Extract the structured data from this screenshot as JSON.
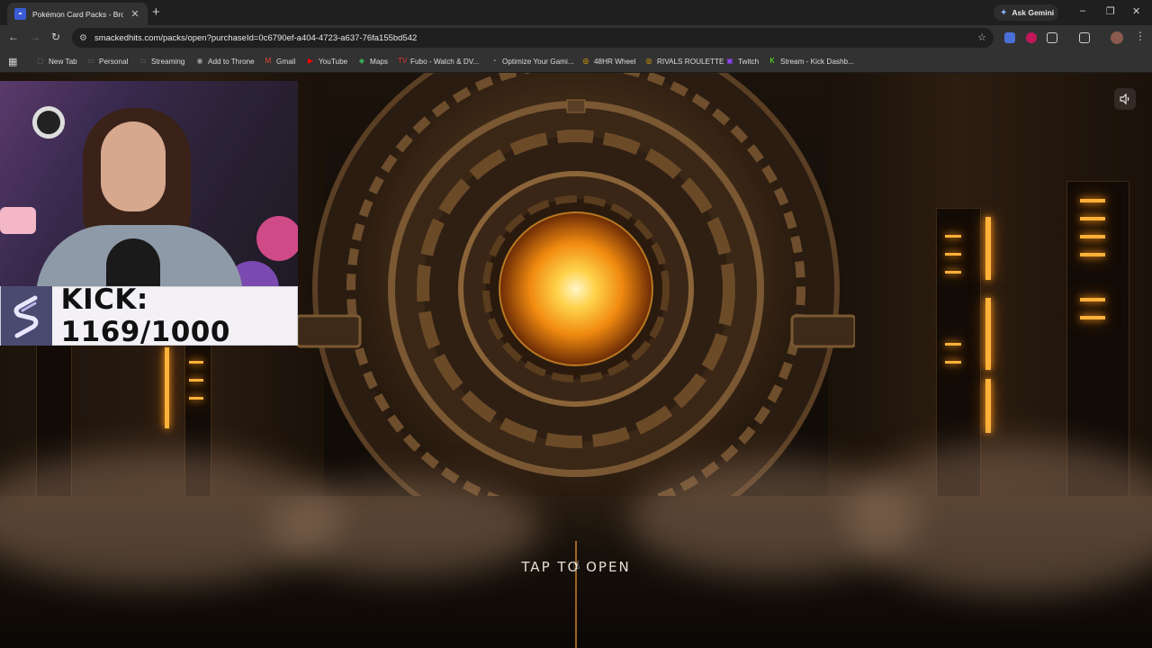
{
  "browser": {
    "tab": {
      "title": "Pokémon Card Packs - Browse",
      "favicon": "pokeball-favicon",
      "close_icon": "✕"
    },
    "new_tab_icon": "+",
    "gemini_label": "Ask Gemini",
    "url": "smackedhits.com/packs/open?purchaseId=0c6790ef-a404-4723-a637-76fa155bd542",
    "window_controls": [
      "–",
      "❐",
      "✕"
    ]
  },
  "bookmarks": [
    {
      "label": "New Tab",
      "icon": "page-icon",
      "color": "#5f6368"
    },
    {
      "label": "Personal",
      "icon": "folder-icon",
      "color": "#5f6368"
    },
    {
      "label": "Streaming",
      "icon": "folder-icon",
      "color": "#5f6368"
    },
    {
      "label": "Add to Throne",
      "icon": "throne-icon",
      "color": "#9aa0a6"
    },
    {
      "label": "Gmail",
      "icon": "gmail-icon",
      "color": "#ea4335"
    },
    {
      "label": "YouTube",
      "icon": "youtube-icon",
      "color": "#ff0000"
    },
    {
      "label": "Maps",
      "icon": "maps-icon",
      "color": "#34a853"
    },
    {
      "label": "Fubo - Watch & DV...",
      "icon": "fubo-icon",
      "color": "#e0342a"
    },
    {
      "label": "Optimize Your Gami...",
      "icon": "gauge-icon",
      "color": "#9aa0a6"
    },
    {
      "label": "48HR Wheel",
      "icon": "wheel-icon",
      "color": "#f2a900"
    },
    {
      "label": "RIVALS ROULETTE",
      "icon": "wheel-icon",
      "color": "#f2a900"
    },
    {
      "label": "Twitch",
      "icon": "twitch-icon",
      "color": "#9146ff"
    },
    {
      "label": "Stream - Kick Dashb...",
      "icon": "kick-icon",
      "color": "#53fc18"
    }
  ],
  "page": {
    "cta": "TAP TO OPEN",
    "sound_icon": "speaker-icon"
  },
  "overlay": {
    "kick_goal": "KICK: 1169/1000"
  }
}
